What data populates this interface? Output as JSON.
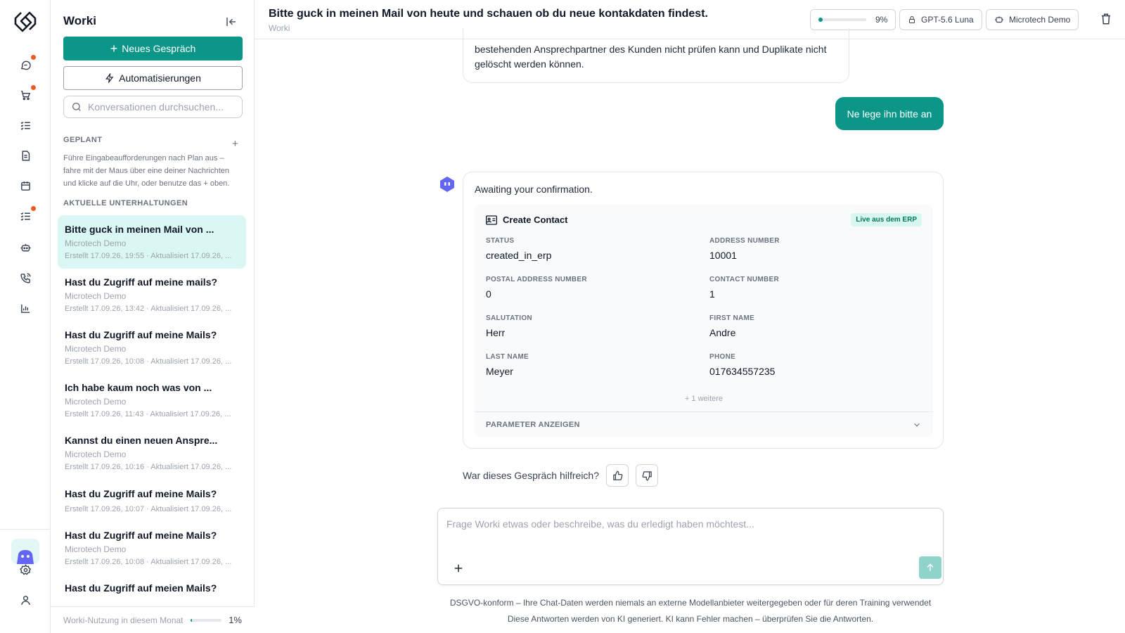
{
  "sidebar": {
    "title": "Worki",
    "new_chat_label": "Neues Gespräch",
    "automations_label": "Automatisierungen",
    "search_placeholder": "Konversationen durchsuchen...",
    "planned_heading": "GEPLANT",
    "planned_description": "Führe Eingabeaufforderungen nach Plan aus – fahre mit der Maus über eine deiner Nachrichten und klicke auf die Uhr, oder benutze das + oben.",
    "recent_heading": "AKTUELLE UNTERHALTUNGEN",
    "conversations": [
      {
        "title": "Bitte guck in meinen Mail von ...",
        "workspace": "Microtech Demo",
        "meta": "Erstellt 17.09.26, 19:55 · Aktualisiert 17.09.26, ..."
      },
      {
        "title": "Hast du Zugriff auf meine mails?",
        "workspace": "Microtech Demo",
        "meta": "Erstellt 17.09.26, 13:42 · Aktualisiert 17.09.26, ..."
      },
      {
        "title": "Hast du Zugriff auf meine Mails?",
        "workspace": "Microtech Demo",
        "meta": "Erstellt 17.09.26, 10:08 · Aktualisiert 17.09.26, ..."
      },
      {
        "title": "Ich habe kaum noch was von ...",
        "workspace": "Microtech Demo",
        "meta": "Erstellt 17.09.26, 11:43 · Aktualisiert 17.09.26, ..."
      },
      {
        "title": "Kannst du einen neuen Anspre...",
        "workspace": "Microtech Demo",
        "meta": "Erstellt 17.09.26, 10:16 · Aktualisiert 17.09.26, ..."
      },
      {
        "title": "Hast du Zugriff auf meine Mails?",
        "workspace": "",
        "meta": "Erstellt 17.09.26, 10:07 · Aktualisiert 17.09.26, ..."
      },
      {
        "title": "Hast du Zugriff auf meine Mails?",
        "workspace": "Microtech Demo",
        "meta": "Erstellt 17.09.26, 10:08 · Aktualisiert 17.09.26, ..."
      },
      {
        "title": "Hast du Zugriff auf meien Mails?",
        "workspace": "",
        "meta": ""
      }
    ],
    "usage_label": "Worki-Nutzung in diesem Monat",
    "usage_percent_text": "1%",
    "usage_fraction": 0.01
  },
  "header": {
    "title": "Bitte guck in meinen Mail von heute und schauen ob du neue kontakdaten findest.",
    "subtitle": "Worki",
    "context_percent_text": "9%",
    "context_fraction": 0.09,
    "model_label": "GPT-5.6 Luna",
    "workspace_label": "Microtech Demo"
  },
  "chat": {
    "previous_message": "bestehenden Ansprechpartner des Kunden nicht prüfen kann und Duplikate nicht gelöscht werden können.",
    "user_message": "Ne lege ihn bitte an",
    "bot_message": "Awaiting your confirmation.",
    "tool_card": {
      "title": "Create Contact",
      "badge": "Live aus dem ERP",
      "fields": [
        {
          "label": "STATUS",
          "value": "created_in_erp"
        },
        {
          "label": "ADDRESS NUMBER",
          "value": "10001"
        },
        {
          "label": "POSTAL ADDRESS NUMBER",
          "value": "0"
        },
        {
          "label": "CONTACT NUMBER",
          "value": "1"
        },
        {
          "label": "SALUTATION",
          "value": "Herr"
        },
        {
          "label": "FIRST NAME",
          "value": "Andre"
        },
        {
          "label": "LAST NAME",
          "value": "Meyer"
        },
        {
          "label": "PHONE",
          "value": "017634557235"
        }
      ],
      "more_label": "+ 1 weitere",
      "params_toggle_label": "PARAMETER ANZEIGEN"
    },
    "feedback_question": "War dieses Gespräch hilfreich?"
  },
  "composer": {
    "placeholder": "Frage Worki etwas oder beschreibe, was du erledigt haben möchtest..."
  },
  "footer": {
    "privacy_note": "DSGVO-konform – Ihre Chat-Daten werden niemals an externe Modellanbieter weitergegeben oder für deren Training verwendet",
    "ai_disclaimer": "Diese Antworten werden von KI generiert. KI kann Fehler machen – überprüfen Sie die Antworten."
  },
  "colors": {
    "accent": "#0b9688",
    "notification": "#f05a22",
    "active_conversation_bg": "#dbf7f3"
  },
  "icons": {
    "rail": [
      "chat-icon",
      "cart-icon",
      "checklist-icon",
      "document-icon",
      "calendar-icon",
      "tasks-icon",
      "robot-icon",
      "phone-icon",
      "chart-icon",
      "settings-icon",
      "user-icon"
    ],
    "notifications_on": [
      "chat-icon",
      "cart-icon",
      "tasks-icon"
    ]
  }
}
